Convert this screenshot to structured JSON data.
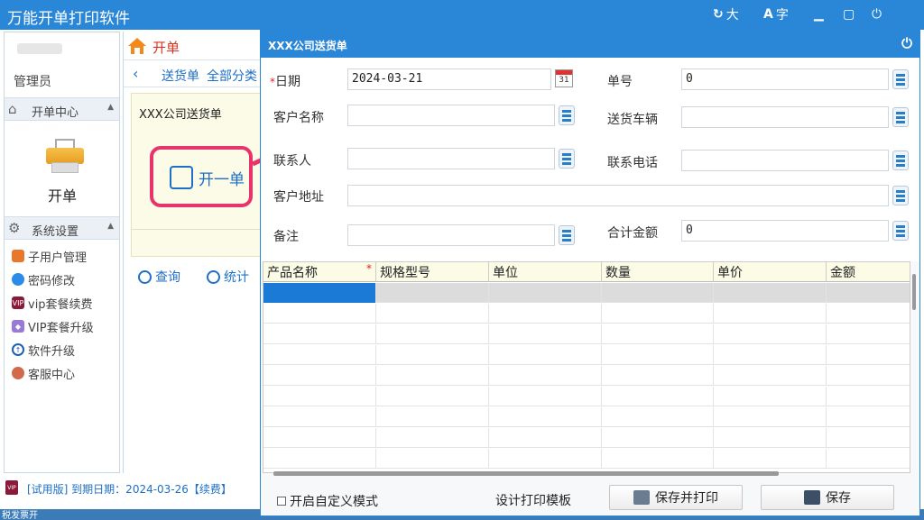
{
  "app": {
    "title": "万能开单打印软件",
    "font_size_label": "大",
    "font_label": "字"
  },
  "sidebar": {
    "user_role": "管理员",
    "section1": "开单中心",
    "kaidan_label": "开单",
    "section2": "系统设置",
    "items": [
      {
        "label": "子用户管理",
        "color": "#e8762b"
      },
      {
        "label": "密码修改",
        "color": "#2b8be8"
      },
      {
        "label": "vip套餐续费",
        "color": "#8b1a3a"
      },
      {
        "label": "VIP套餐升级",
        "color": "#9a7ad8"
      },
      {
        "label": "软件升级",
        "color": "#1b5fb8"
      },
      {
        "label": "客服中心",
        "color": "#d06a4a"
      }
    ]
  },
  "mid": {
    "title": "开单",
    "crumb1": "送货单",
    "crumb2": "全部分类",
    "card_title": "XXX公司送货单",
    "new_order": "开一单",
    "query": "查询",
    "stats": "统计"
  },
  "status": {
    "vip_text": "VIP",
    "text": "[试用版] 到期日期：2024-03-26【续费】"
  },
  "taskbar": {
    "text": "税发票开"
  },
  "dialog": {
    "title": "XXX公司送货单",
    "fields": {
      "date_label": "日期",
      "date_value": "2024-03-21",
      "calendar_day": "31",
      "order_no_label": "单号",
      "order_no_value": "0",
      "customer_label": "客户名称",
      "vehicle_label": "送货车辆",
      "contact_label": "联系人",
      "phone_label": "联系电话",
      "address_label": "客户地址",
      "note_label": "备注",
      "total_label": "合计金额",
      "total_value": "0"
    },
    "grid": {
      "columns": [
        "产品名称",
        "规格型号",
        "单位",
        "数量",
        "单价",
        "金额"
      ]
    },
    "footer": {
      "custom_mode": "开启自定义模式",
      "design_template": "设计打印模板",
      "save_print": "保存并打印",
      "save": "保存"
    }
  }
}
